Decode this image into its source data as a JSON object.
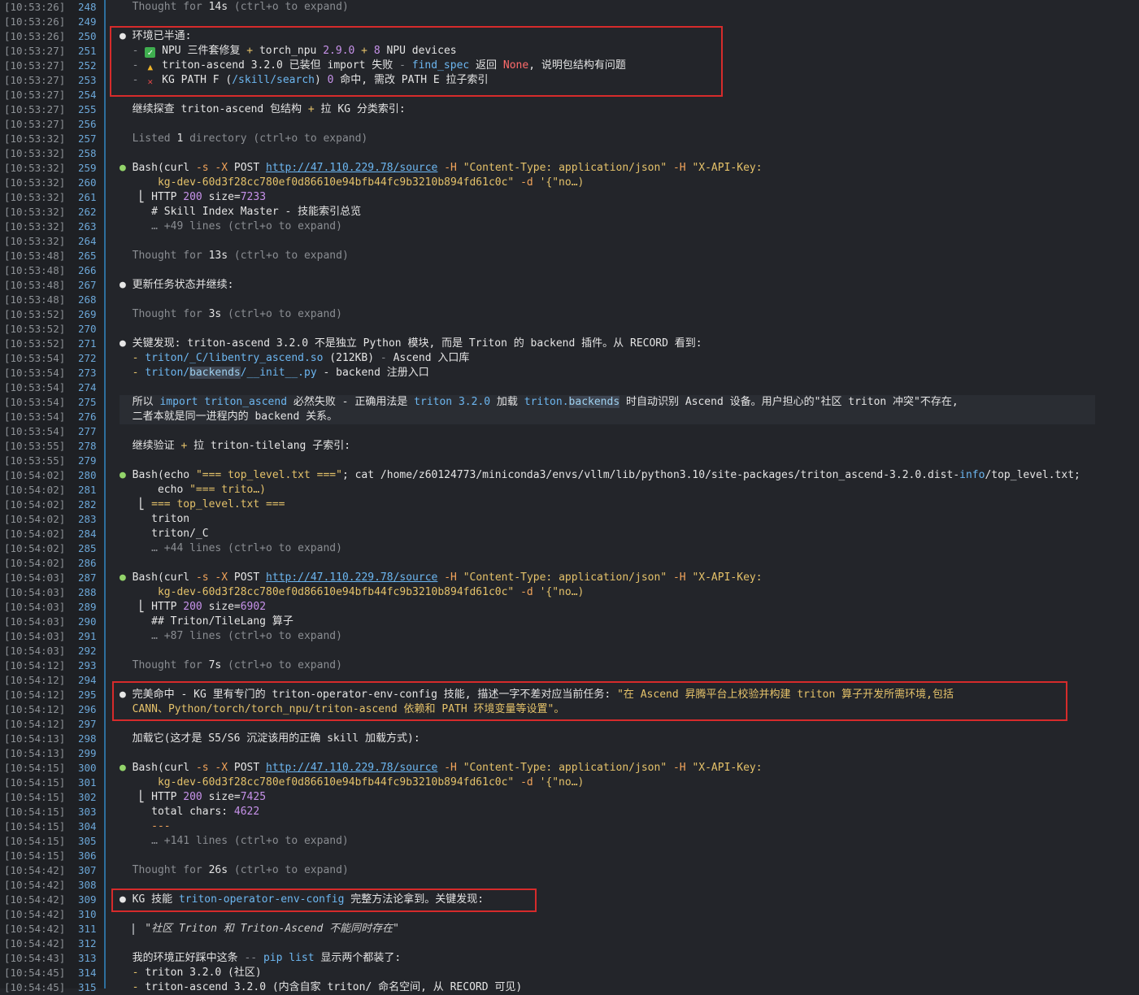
{
  "gutter": [
    [
      "[10:53:26]",
      "248"
    ],
    [
      "[10:53:26]",
      "249"
    ],
    [
      "[10:53:26]",
      "250"
    ],
    [
      "[10:53:27]",
      "251"
    ],
    [
      "[10:53:27]",
      "252"
    ],
    [
      "[10:53:27]",
      "253"
    ],
    [
      "[10:53:27]",
      "254"
    ],
    [
      "[10:53:27]",
      "255"
    ],
    [
      "[10:53:27]",
      "256"
    ],
    [
      "[10:53:32]",
      "257"
    ],
    [
      "[10:53:32]",
      "258"
    ],
    [
      "[10:53:32]",
      "259"
    ],
    [
      "[10:53:32]",
      "260"
    ],
    [
      "[10:53:32]",
      "261"
    ],
    [
      "[10:53:32]",
      "262"
    ],
    [
      "[10:53:32]",
      "263"
    ],
    [
      "[10:53:32]",
      "264"
    ],
    [
      "[10:53:48]",
      "265"
    ],
    [
      "[10:53:48]",
      "266"
    ],
    [
      "[10:53:48]",
      "267"
    ],
    [
      "[10:53:48]",
      "268"
    ],
    [
      "[10:53:52]",
      "269"
    ],
    [
      "[10:53:52]",
      "270"
    ],
    [
      "[10:53:52]",
      "271"
    ],
    [
      "[10:53:54]",
      "272"
    ],
    [
      "[10:53:54]",
      "273"
    ],
    [
      "[10:53:54]",
      "274"
    ],
    [
      "[10:53:54]",
      "275"
    ],
    [
      "[10:53:54]",
      "276"
    ],
    [
      "[10:53:54]",
      "277"
    ],
    [
      "[10:53:55]",
      "278"
    ],
    [
      "[10:53:55]",
      "279"
    ],
    [
      "[10:54:02]",
      "280"
    ],
    [
      "[10:54:02]",
      "281"
    ],
    [
      "[10:54:02]",
      "282"
    ],
    [
      "[10:54:02]",
      "283"
    ],
    [
      "[10:54:02]",
      "284"
    ],
    [
      "[10:54:02]",
      "285"
    ],
    [
      "[10:54:02]",
      "286"
    ],
    [
      "[10:54:03]",
      "287"
    ],
    [
      "[10:54:03]",
      "288"
    ],
    [
      "[10:54:03]",
      "289"
    ],
    [
      "[10:54:03]",
      "290"
    ],
    [
      "[10:54:03]",
      "291"
    ],
    [
      "[10:54:03]",
      "292"
    ],
    [
      "[10:54:12]",
      "293"
    ],
    [
      "[10:54:12]",
      "294"
    ],
    [
      "[10:54:12]",
      "295"
    ],
    [
      "[10:54:12]",
      "296"
    ],
    [
      "[10:54:12]",
      "297"
    ],
    [
      "[10:54:13]",
      "298"
    ],
    [
      "[10:54:13]",
      "299"
    ],
    [
      "[10:54:15]",
      "300"
    ],
    [
      "[10:54:15]",
      "301"
    ],
    [
      "[10:54:15]",
      "302"
    ],
    [
      "[10:54:15]",
      "303"
    ],
    [
      "[10:54:15]",
      "304"
    ],
    [
      "[10:54:15]",
      "305"
    ],
    [
      "[10:54:15]",
      "306"
    ],
    [
      "[10:54:42]",
      "307"
    ],
    [
      "[10:54:42]",
      "308"
    ],
    [
      "[10:54:42]",
      "309"
    ],
    [
      "[10:54:42]",
      "310"
    ],
    [
      "[10:54:42]",
      "311"
    ],
    [
      "[10:54:42]",
      "312"
    ],
    [
      "[10:54:43]",
      "313"
    ],
    [
      "[10:54:45]",
      "314"
    ],
    [
      "[10:54:45]",
      "315"
    ]
  ],
  "lines": [
    [
      [
        "  Thought for ",
        "dim"
      ],
      [
        "14s",
        "w"
      ],
      [
        " (ctrl+o to expand)",
        "dim"
      ]
    ],
    [],
    [
      [
        "● ",
        "bullet"
      ],
      [
        "环境已半通:",
        "w"
      ]
    ],
    [
      [
        "  - ",
        "dim"
      ],
      [
        "✓",
        "ico-check"
      ],
      [
        " NPU 三件套修复 ",
        "w"
      ],
      [
        "+ ",
        "y"
      ],
      [
        "torch_npu ",
        "w"
      ],
      [
        "2.9.0",
        "p"
      ],
      [
        " + ",
        "y"
      ],
      [
        "8",
        "p"
      ],
      [
        " NPU devices",
        "w"
      ]
    ],
    [
      [
        "  - ",
        "dim"
      ],
      [
        "▲",
        "ico-warn"
      ],
      [
        " triton-ascend 3.2.0 已装但 import 失败 ",
        "w"
      ],
      [
        "- ",
        "dim"
      ],
      [
        "find_spec",
        "b"
      ],
      [
        " 返回 ",
        "w"
      ],
      [
        "None",
        "r"
      ],
      [
        ", 说明包结构有问题",
        "w"
      ]
    ],
    [
      [
        "  - ",
        "dim"
      ],
      [
        "✕",
        "ico-x"
      ],
      [
        " KG PATH F (",
        "w"
      ],
      [
        "/skill/search",
        "b"
      ],
      [
        ") ",
        "w"
      ],
      [
        "0",
        "p"
      ],
      [
        " 命中, 需改 PATH E 拉子索引",
        "w"
      ]
    ],
    [],
    [
      [
        "  继续探查 triton-ascend 包结构 ",
        "w"
      ],
      [
        "+ ",
        "y"
      ],
      [
        "拉 KG 分类索引:",
        "w"
      ]
    ],
    [],
    [
      [
        "  Listed ",
        "dim"
      ],
      [
        "1",
        "w"
      ],
      [
        " directory (ctrl+o to expand)",
        "dim"
      ]
    ],
    [],
    [
      [
        "● ",
        "g"
      ],
      [
        "Bash(curl ",
        "w"
      ],
      [
        "-s -X ",
        "o"
      ],
      [
        "POST ",
        "w"
      ],
      [
        "http://47.110.229.78/source",
        "u"
      ],
      [
        " -H ",
        "o"
      ],
      [
        "\"Content-Type: application/json\"",
        "y"
      ],
      [
        " -H ",
        "o"
      ],
      [
        "\"X-API-Key:",
        "y"
      ]
    ],
    [
      [
        "      kg-dev-60d3f28cc780ef0d86610e94bfb44fc9b3210b894fd61c0c\"",
        "y"
      ],
      [
        " -d ",
        "o"
      ],
      [
        "'{\"no…)",
        "y"
      ]
    ],
    [
      [
        "   ⎣ HTTP ",
        "w"
      ],
      [
        "200",
        "p"
      ],
      [
        " size=",
        "w"
      ],
      [
        "7233",
        "p"
      ]
    ],
    [
      [
        "     # Skill Index Master - 技能索引总览",
        "w"
      ]
    ],
    [
      [
        "     … +49 lines (ctrl+o to expand)",
        "dim"
      ]
    ],
    [],
    [
      [
        "  Thought for ",
        "dim"
      ],
      [
        "13s",
        "w"
      ],
      [
        " (ctrl+o to expand)",
        "dim"
      ]
    ],
    [],
    [
      [
        "● ",
        "bullet"
      ],
      [
        "更新任务状态并继续:",
        "w"
      ]
    ],
    [],
    [
      [
        "  Thought for ",
        "dim"
      ],
      [
        "3s",
        "w"
      ],
      [
        " (ctrl+o to expand)",
        "dim"
      ]
    ],
    [],
    [
      [
        "● ",
        "bullet"
      ],
      [
        "关键发现: triton-ascend 3.2.0 不是独立 Python 模块, 而是 Triton 的 backend 插件。从 RECORD 看到:",
        "w"
      ]
    ],
    [
      [
        "  - ",
        "y"
      ],
      [
        "triton/_C/libentry_ascend.so",
        "b"
      ],
      [
        " (212KB) ",
        "w"
      ],
      [
        "- ",
        "dim"
      ],
      [
        "Ascend 入口库",
        "w"
      ]
    ],
    [
      [
        "  - ",
        "y"
      ],
      [
        "triton/",
        "b"
      ],
      [
        "backends",
        "hl"
      ],
      [
        "/__init__.py",
        "b"
      ],
      [
        " - backend 注册入口",
        "w"
      ]
    ],
    [],
    [
      [
        "  所以 ",
        "w"
      ],
      [
        "import triton_ascend",
        "b"
      ],
      [
        " 必然失败 - 正确用法是 ",
        "w"
      ],
      [
        "triton 3.2.0",
        "b"
      ],
      [
        " 加载 ",
        "w"
      ],
      [
        "triton.",
        "b"
      ],
      [
        "backends",
        "hl"
      ],
      [
        " 时自动识别 Ascend 设备。用户担心的\"社区 triton 冲突\"不存在,",
        "w"
      ]
    ],
    [
      [
        "  二者本就是同一进程内的 backend 关系。",
        "w"
      ]
    ],
    [],
    [
      [
        "  继续验证 ",
        "w"
      ],
      [
        "+ ",
        "y"
      ],
      [
        "拉 triton-tilelang 子索引:",
        "w"
      ]
    ],
    [],
    [
      [
        "● ",
        "g"
      ],
      [
        "Bash(",
        "w"
      ],
      [
        "echo ",
        "w"
      ],
      [
        "\"=== top_level.txt ===\"",
        "y"
      ],
      [
        "; cat /home/z60124773/miniconda3/envs/vllm/lib/python3.10/site-packages/triton_ascend-3.2.0.dist-",
        "w"
      ],
      [
        "info",
        "b"
      ],
      [
        "/top_level.txt;",
        "w"
      ]
    ],
    [
      [
        "      echo ",
        "w"
      ],
      [
        "\"=== trito…)",
        "y"
      ]
    ],
    [
      [
        "   ⎣ ",
        "w"
      ],
      [
        "=== top_level.txt ===",
        "y"
      ]
    ],
    [
      [
        "     triton",
        "w"
      ]
    ],
    [
      [
        "     triton/_C",
        "w"
      ]
    ],
    [
      [
        "     … +44 lines (ctrl+o to expand)",
        "dim"
      ]
    ],
    [],
    [
      [
        "● ",
        "g"
      ],
      [
        "Bash(curl ",
        "w"
      ],
      [
        "-s -X ",
        "o"
      ],
      [
        "POST ",
        "w"
      ],
      [
        "http://47.110.229.78/source",
        "u"
      ],
      [
        " -H ",
        "o"
      ],
      [
        "\"Content-Type: application/json\"",
        "y"
      ],
      [
        " -H ",
        "o"
      ],
      [
        "\"X-API-Key:",
        "y"
      ]
    ],
    [
      [
        "      kg-dev-60d3f28cc780ef0d86610e94bfb44fc9b3210b894fd61c0c\"",
        "y"
      ],
      [
        " -d ",
        "o"
      ],
      [
        "'{\"no…)",
        "y"
      ]
    ],
    [
      [
        "   ⎣ HTTP ",
        "w"
      ],
      [
        "200",
        "p"
      ],
      [
        " size=",
        "w"
      ],
      [
        "6902",
        "p"
      ]
    ],
    [
      [
        "     ## Triton/TileLang 算子",
        "w"
      ]
    ],
    [
      [
        "     … +87 lines (ctrl+o to expand)",
        "dim"
      ]
    ],
    [],
    [
      [
        "  Thought for ",
        "dim"
      ],
      [
        "7s",
        "w"
      ],
      [
        " (ctrl+o to expand)",
        "dim"
      ]
    ],
    [],
    [
      [
        "● ",
        "bullet"
      ],
      [
        "完美命中 - KG 里有专门的 triton-operator-env-config 技能, 描述一字不差对应当前任务: ",
        "w"
      ],
      [
        "\"在 Ascend 昇腾平台上校验并构建 triton 算子开发所需环境,包括",
        "y"
      ]
    ],
    [
      [
        "  CANN、Python/torch/torch_npu/triton-ascend 依赖和 PATH 环境变量等设置\"。",
        "y"
      ]
    ],
    [],
    [
      [
        "  加载它(这才是 S5/S6 沉淀该用的正确 skill 加载方式):",
        "w"
      ]
    ],
    [],
    [
      [
        "● ",
        "g"
      ],
      [
        "Bash(curl ",
        "w"
      ],
      [
        "-s -X ",
        "o"
      ],
      [
        "POST ",
        "w"
      ],
      [
        "http://47.110.229.78/source",
        "u"
      ],
      [
        " -H ",
        "o"
      ],
      [
        "\"Content-Type: application/json\"",
        "y"
      ],
      [
        " -H ",
        "o"
      ],
      [
        "\"X-API-Key:",
        "y"
      ]
    ],
    [
      [
        "      kg-dev-60d3f28cc780ef0d86610e94bfb44fc9b3210b894fd61c0c\"",
        "y"
      ],
      [
        " -d ",
        "o"
      ],
      [
        "'{\"no…)",
        "y"
      ]
    ],
    [
      [
        "   ⎣ HTTP ",
        "w"
      ],
      [
        "200",
        "p"
      ],
      [
        " size=",
        "w"
      ],
      [
        "7425",
        "p"
      ]
    ],
    [
      [
        "     total chars: ",
        "w"
      ],
      [
        "4622",
        "p"
      ]
    ],
    [
      [
        "     ---",
        "o"
      ]
    ],
    [
      [
        "     … +141 lines (ctrl+o to expand)",
        "dim"
      ]
    ],
    [],
    [
      [
        "  Thought for ",
        "dim"
      ],
      [
        "26s",
        "w"
      ],
      [
        " (ctrl+o to expand)",
        "dim"
      ]
    ],
    [],
    [
      [
        "● ",
        "bullet"
      ],
      [
        "KG 技能 ",
        "w"
      ],
      [
        "triton-operator-env-config",
        "b"
      ],
      [
        " 完整方法论拿到。关键发现:",
        "w"
      ]
    ],
    [],
    [
      [
        "    \"社区 Triton 和 Triton-Ascend 不能同时存在\"",
        "it"
      ]
    ],
    [],
    [
      [
        "  我的环境正好踩中这条 ",
        "w"
      ],
      [
        "--",
        "dim"
      ],
      [
        " ",
        "w"
      ],
      [
        "pip list",
        "b"
      ],
      [
        " 显示两个都装了:",
        "w"
      ]
    ],
    [
      [
        "  - ",
        "y"
      ],
      [
        "triton 3.2.0 (社区)",
        "w"
      ]
    ],
    [
      [
        "  - ",
        "y"
      ],
      [
        "triton-ascend 3.2.0 (内含自家 triton/ 命名空间, 从 RECORD 可见)",
        "w"
      ]
    ]
  ]
}
